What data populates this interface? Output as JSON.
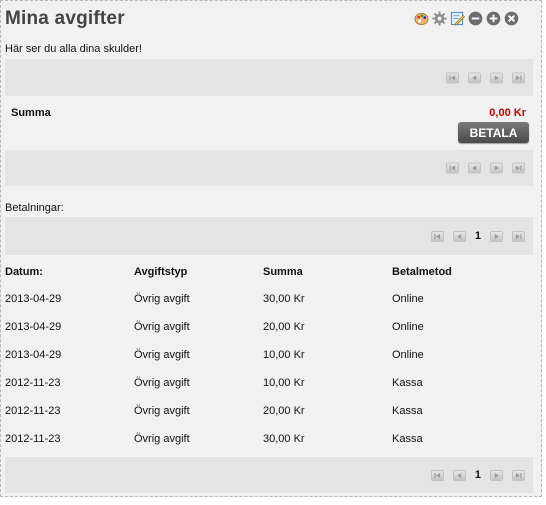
{
  "header": {
    "title": "Mina avgifter",
    "icons": [
      "palette-icon",
      "gear-icon",
      "edit-icon",
      "minimize-icon",
      "add-icon",
      "close-icon"
    ]
  },
  "debts": {
    "intro": "Här ser du alla dina skulder!",
    "summa_label": "Summa",
    "summa_value": "0,00 Kr",
    "pay_label": "BETALA"
  },
  "payments": {
    "label": "Betalningar:",
    "page": "1",
    "columns": [
      "Datum:",
      "Avgiftstyp",
      "Summa",
      "Betalmetod"
    ],
    "rows": [
      [
        "2013-04-29",
        "Övrig avgift",
        "30,00 Kr",
        "Online"
      ],
      [
        "2013-04-29",
        "Övrig avgift",
        "20,00 Kr",
        "Online"
      ],
      [
        "2013-04-29",
        "Övrig avgift",
        "10,00 Kr",
        "Online"
      ],
      [
        "2012-11-23",
        "Övrig avgift",
        "10,00 Kr",
        "Kassa"
      ],
      [
        "2012-11-23",
        "Övrig avgift",
        "20,00 Kr",
        "Kassa"
      ],
      [
        "2012-11-23",
        "Övrig avgift",
        "30,00 Kr",
        "Kassa"
      ]
    ]
  },
  "colors": {
    "panel_bg": "#f1f1f1",
    "bar_bg": "#e4e4e4",
    "sum_red": "#c00000",
    "button_dark": "#555555"
  }
}
